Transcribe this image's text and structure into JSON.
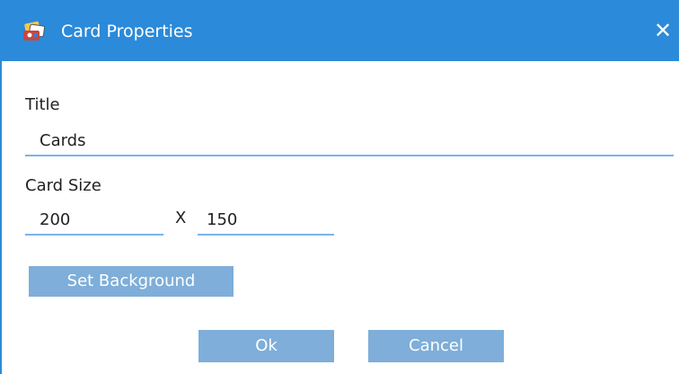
{
  "window": {
    "title": "Card Properties",
    "app_icon": "cards-app-icon",
    "close_glyph": "✕"
  },
  "form": {
    "title_label": "Title",
    "title_value": "Cards",
    "size_label": "Card Size",
    "width_value": "200",
    "separator": "X",
    "height_value": "150"
  },
  "buttons": {
    "set_background": "Set Background",
    "ok": "Ok",
    "cancel": "Cancel"
  },
  "colors": {
    "titlebar": "#2b8ad9",
    "button": "#7eaed9",
    "field_underline": "#7bb3e6"
  }
}
